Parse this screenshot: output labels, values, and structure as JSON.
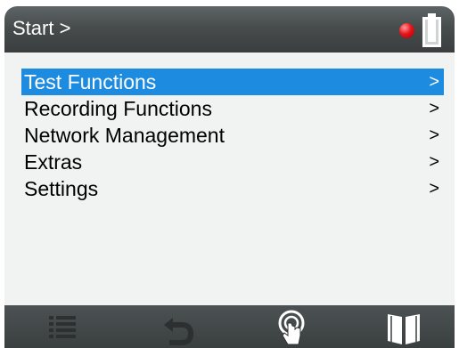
{
  "header": {
    "title": "Start >",
    "status_icon": "recording-indicator-icon",
    "status_color": "#e8141b",
    "battery_icon": "battery-icon",
    "battery_level": 0.9
  },
  "menu": {
    "items": [
      {
        "label": "Test Functions",
        "arrow": ">",
        "selected": true
      },
      {
        "label": "Recording Functions",
        "arrow": ">",
        "selected": false
      },
      {
        "label": "Network Management",
        "arrow": ">",
        "selected": false
      },
      {
        "label": "Extras",
        "arrow": ">",
        "selected": false
      },
      {
        "label": "Settings",
        "arrow": ">",
        "selected": false
      }
    ],
    "selected_color": "#1d8ce0"
  },
  "footer": {
    "buttons": [
      {
        "icon": "list-icon",
        "enabled": false
      },
      {
        "icon": "back-icon",
        "enabled": false
      },
      {
        "icon": "touch-icon",
        "enabled": true
      },
      {
        "icon": "manual-book-icon",
        "enabled": true
      }
    ]
  }
}
